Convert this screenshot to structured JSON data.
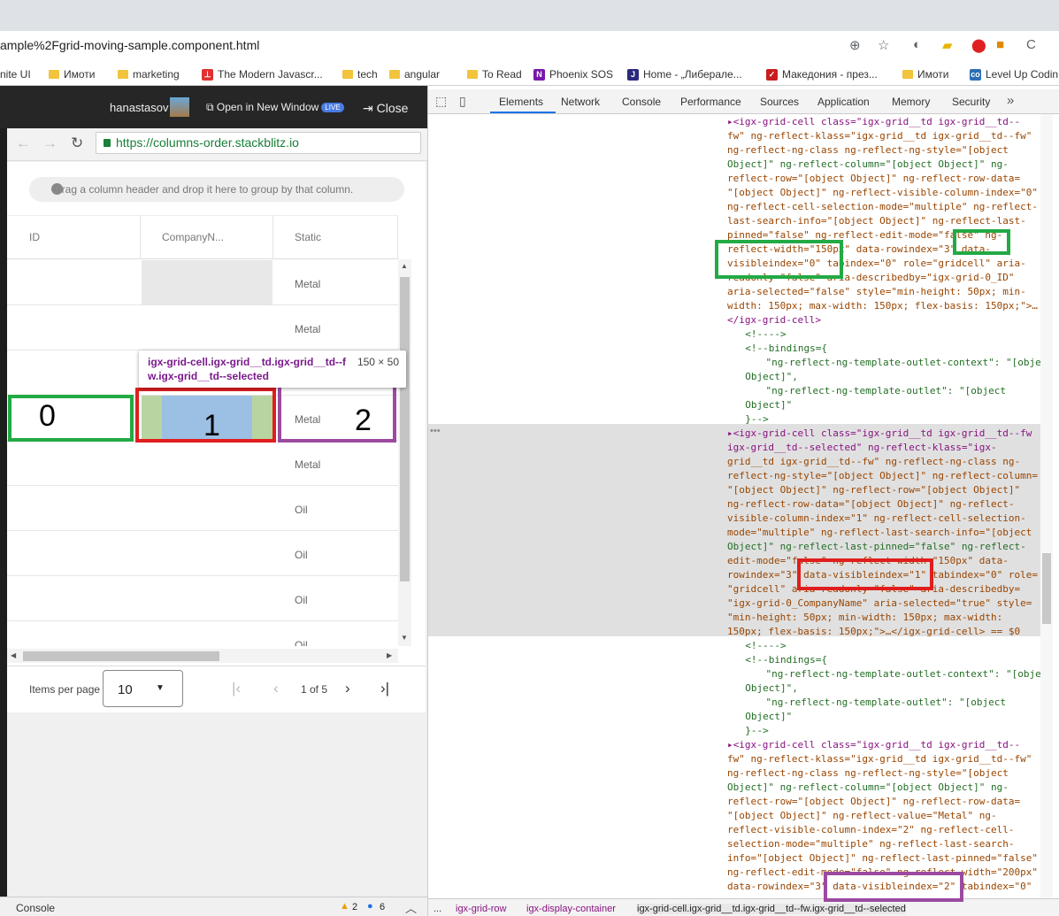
{
  "browser": {
    "url": "ample%2Fgrid-moving-sample.component.html",
    "bookmarks": [
      {
        "label": "nite UI",
        "icon": "none"
      },
      {
        "label": "Имоти",
        "icon": "folder"
      },
      {
        "label": "marketing",
        "icon": "folder"
      },
      {
        "label": "The Modern Javascr...",
        "icon": "angular-red"
      },
      {
        "label": "tech",
        "icon": "folder"
      },
      {
        "label": "angular",
        "icon": "folder"
      },
      {
        "label": "To Read",
        "icon": "folder"
      },
      {
        "label": "Phoenix SOS",
        "icon": "onenote"
      },
      {
        "label": "Home - „Либерале...",
        "icon": "flag"
      },
      {
        "label": "Македония - през...",
        "icon": "red-check"
      },
      {
        "label": "Имоти",
        "icon": "folder"
      },
      {
        "label": "Level Up Codin",
        "icon": "co"
      }
    ]
  },
  "stackblitz": {
    "username": "hanastasov",
    "open_new_window": "Open in New Window",
    "live_badge": "LIVE",
    "close": "Close",
    "preview_url": "https://columns-order.stackblitz.io",
    "console_label": "Console",
    "warnings": "2",
    "infos": "6"
  },
  "grid": {
    "group_area_text": "Drag a column header and drop it here to group by that column.",
    "headers": [
      "ID",
      "CompanyN...",
      "Static"
    ],
    "rows": [
      "Metal",
      "Metal",
      "",
      "Metal",
      "Metal",
      "Oil",
      "Oil",
      "Oil",
      "Oil"
    ],
    "items_per_page_label": "Items per page",
    "items_per_page": "10",
    "page_info": "1 of 5"
  },
  "annotations": {
    "label0": "0",
    "label1": "1",
    "label2": "2",
    "tooltip_selector": "igx-grid-cell.igx-grid__td.igx-grid__td--fw.igx-grid__td--selected",
    "tooltip_size": "150 × 50",
    "colors": {
      "green": "#22aa44",
      "red": "#e01e1e",
      "purple": "#9b4aa0"
    }
  },
  "devtools": {
    "tabs": [
      "Elements",
      "Network",
      "Console",
      "Performance",
      "Sources",
      "Application",
      "Memory",
      "Security"
    ],
    "active_tab": "Elements",
    "code_lines": [
      "▸<igx-grid-cell class=\"igx-grid__td igx-grid__td--",
      "fw\" ng-reflect-klass=\"igx-grid__td igx-grid__td--fw\"",
      "ng-reflect-ng-class ng-reflect-ng-style=\"[object",
      "Object]\" ng-reflect-column=\"[object Object]\" ng-",
      "reflect-row=\"[object Object]\" ng-reflect-row-data=",
      "\"[object Object]\" ng-reflect-visible-column-index=\"0\"",
      "ng-reflect-cell-selection-mode=\"multiple\" ng-reflect-",
      "last-search-info=\"[object Object]\" ng-reflect-last-",
      "pinned=\"false\" ng-reflect-edit-mode=\"false\" ng-",
      "reflect-width=\"150px\" data-rowindex=\"3\" data-",
      "visibleindex=\"0\" tabindex=\"0\" role=\"gridcell\" aria-",
      "readonly=\"false\" aria-describedby=\"igx-grid-0_ID\"",
      "aria-selected=\"false\" style=\"min-height: 50px; min-",
      "width: 150px; max-width: 150px; flex-basis: 150px;\">…",
      "</igx-grid-cell>",
      "  <!---->",
      "  <!--bindings={",
      "    \"ng-reflect-ng-template-outlet-context\": \"[object",
      "  Object]\",",
      "    \"ng-reflect-ng-template-outlet\": \"[object",
      "  Object]\"",
      "  }-->",
      "▸<igx-grid-cell class=\"igx-grid__td igx-grid__td--fw",
      "igx-grid__td--selected\" ng-reflect-klass=\"igx-",
      "grid__td igx-grid__td--fw\" ng-reflect-ng-class ng-",
      "reflect-ng-style=\"[object Object]\" ng-reflect-column=",
      "\"[object Object]\" ng-reflect-row=\"[object Object]\"",
      "ng-reflect-row-data=\"[object Object]\" ng-reflect-",
      "visible-column-index=\"1\" ng-reflect-cell-selection-",
      "mode=\"multiple\" ng-reflect-last-search-info=\"[object",
      "Object]\" ng-reflect-last-pinned=\"false\" ng-reflect-",
      "edit-mode=\"false\" ng-reflect-width=\"150px\" data-",
      "rowindex=\"3\" data-visibleindex=\"1\" tabindex=\"0\" role=",
      "\"gridcell\" aria-readonly=\"false\" aria-describedby=",
      "\"igx-grid-0_CompanyName\" aria-selected=\"true\" style=",
      "\"min-height: 50px; min-width: 150px; max-width:",
      "150px; flex-basis: 150px;\">…</igx-grid-cell> == $0",
      "  <!---->",
      "  <!--bindings={",
      "    \"ng-reflect-ng-template-outlet-context\": \"[object",
      "  Object]\",",
      "    \"ng-reflect-ng-template-outlet\": \"[object",
      "  Object]\"",
      "  }-->",
      "▸<igx-grid-cell class=\"igx-grid__td igx-grid__td--",
      "fw\" ng-reflect-klass=\"igx-grid__td igx-grid__td--fw\"",
      "ng-reflect-ng-class ng-reflect-ng-style=\"[object",
      "Object]\" ng-reflect-column=\"[object Object]\" ng-",
      "reflect-row=\"[object Object]\" ng-reflect-row-data=",
      "\"[object Object]\" ng-reflect-value=\"Metal\" ng-",
      "reflect-visible-column-index=\"2\" ng-reflect-cell-",
      "selection-mode=\"multiple\" ng-reflect-last-search-",
      "info=\"[object Object]\" ng-reflect-last-pinned=\"false\"",
      "ng-reflect-edit-mode=\"false\" ng-reflect-width=\"200px\"",
      "data-rowindex=\"3\" data-visibleindex=\"2\" tabindex=\"0\""
    ],
    "breadcrumb": [
      "...",
      "igx-grid-row",
      "igx-display-container",
      "igx-grid-cell.igx-grid__td.igx-grid__td--fw.igx-grid__td--selected"
    ]
  }
}
